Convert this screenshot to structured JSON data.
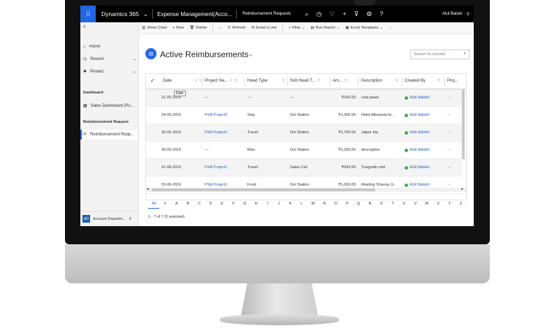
{
  "topbar": {
    "brand": "Dynamics 365",
    "app": "Expense Management(Acco...",
    "crumb": "Reimbursement Requests",
    "user": "Atul Baluni"
  },
  "sidebar": {
    "items": [
      {
        "label": "Home",
        "icon": "home-icon"
      },
      {
        "label": "Recent",
        "icon": "clock-icon"
      },
      {
        "label": "Pinned",
        "icon": "pin-icon"
      }
    ],
    "groups": [
      {
        "title": "Dashboard",
        "items": [
          "Sales Dashboard (Po..."
        ]
      },
      {
        "title": "Reimbursement Request",
        "items": [
          "Reimbursement Requ..."
        ]
      }
    ],
    "area": {
      "badge": "AD",
      "label": "Account Departm..."
    }
  },
  "commands": [
    "Show Chart",
    "New",
    "Delete",
    "Refresh",
    "Email a Link",
    "Flow",
    "Run Report",
    "Excel Templates"
  ],
  "view": {
    "title": "Active Reimbursements",
    "search_placeholder": "Search for records"
  },
  "table": {
    "columns": [
      "Date",
      "Project Na...",
      "Head Type",
      "Sub Head T...",
      "Am...",
      "Description",
      "Created By",
      "Proj..."
    ],
    "tooltip": "Date",
    "rows": [
      [
        "21-05-2019",
        "---",
        "---",
        "---",
        "₹200.00",
        "chai paani",
        "Atul Baluni",
        "···"
      ],
      [
        "24-05-2019",
        "PSA Project2",
        "Stay",
        "Out Station",
        "₹1,000.00",
        "Hotel Alknanda bi...",
        "Atul Baluni",
        "···"
      ],
      [
        "26-05-2019",
        "PSA Project1",
        "Travel",
        "Out Station",
        "₹2,700.00",
        "Jaipur trip",
        "Atul Baluni",
        "···"
      ],
      [
        "30-05-2019",
        "---",
        "Misc",
        "Out Station",
        "₹1,200.00",
        "description",
        "Atul Baluni",
        "···"
      ],
      [
        "01-06-2019",
        "PSA Project1",
        "Travel",
        "Sales Call",
        "₹569.00",
        "Tungnath visit",
        "Atul Baluni",
        "···"
      ],
      [
        "03-06-2019",
        "PSA Project1",
        "Food",
        "Out Station",
        "₹1,650.00",
        "Meeting Sharma Ji...",
        "Atul Baluni",
        "···"
      ]
    ]
  },
  "alphabet": [
    "All",
    "#",
    "A",
    "B",
    "C",
    "D",
    "E",
    "F",
    "G",
    "H",
    "I",
    "J",
    "K",
    "L",
    "M",
    "N",
    "O",
    "P",
    "Q",
    "R",
    "S",
    "T",
    "U",
    "V",
    "W",
    "X",
    "Y",
    "Z"
  ],
  "status": "1 - 7 of 7 (0 selected)",
  "colors": {
    "accent": "#2266e3",
    "topbar": "#000000",
    "presence": "#3fae49"
  }
}
